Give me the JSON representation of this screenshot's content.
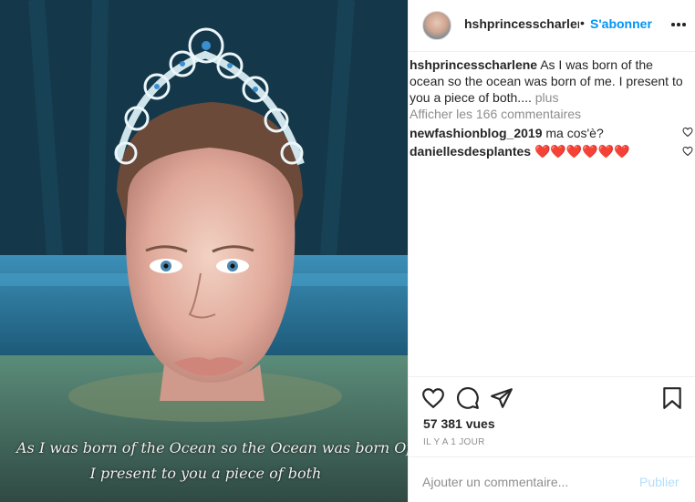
{
  "post": {
    "image_caption_lines": [
      "As I was born of the Ocean so the Ocean was born Of me.",
      "I present to you a piece of both"
    ]
  },
  "header": {
    "username": "hshprincesscharlene",
    "separator": "•",
    "follow_label": "S'abonner"
  },
  "caption": {
    "username": "hshprincesscharlene",
    "text": "As I was born of the ocean so the ocean was born of me. I present to you a piece of both....",
    "more_label": "plus"
  },
  "view_all_comments": "Afficher les 166 commentaires",
  "comments": [
    {
      "username": "newfashionblog_2019",
      "text": "ma cos'è?"
    },
    {
      "username": "daniellesdesplantes",
      "text": "❤️❤️❤️❤️❤️❤️"
    }
  ],
  "stats": {
    "views": "57 381 vues",
    "time": "IL Y A 1 JOUR"
  },
  "add_comment": {
    "placeholder": "Ajouter un commentaire...",
    "publish_label": "Publier"
  },
  "colors": {
    "accent": "#0095f6",
    "publish_disabled": "#b2dffc",
    "secondary_text": "#8e8e8e"
  },
  "icons": [
    "more-horizontal-icon",
    "heart-icon",
    "comment-icon",
    "share-icon",
    "bookmark-icon",
    "small-heart-icon"
  ]
}
